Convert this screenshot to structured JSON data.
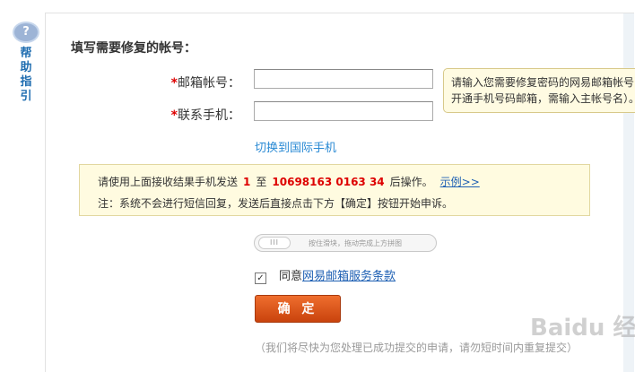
{
  "help": {
    "icon_text": "?",
    "label": "帮助指引"
  },
  "form": {
    "title": "填写需要修复的帐号：",
    "email_label": "邮箱帐号：",
    "email_value": "",
    "phone_label": "联系手机：",
    "phone_value": "",
    "required_mark": "*",
    "tooltip": "请输入您需要修复密码的网易邮箱帐号（如开通手机号码邮箱，需输入主帐号名）。",
    "switch_link": "切换到国际手机"
  },
  "notice": {
    "line1_prefix": "请使用上面接收结果手机发送",
    "code": "1",
    "to_text": "至",
    "number": "10698163 0163 34",
    "line1_suffix": "后操作。",
    "example_link": "示例>>",
    "line2": "注：系统不会进行短信回复，发送后直接点击下方【确定】按钮开始申诉。"
  },
  "slider": {
    "knob_text": "III",
    "hint": "按住滑块，拖动完成上方拼图"
  },
  "agreement": {
    "check_mark": "✓",
    "text": "同意",
    "link": "网易邮箱服务条款"
  },
  "confirm_button": "确 定",
  "footer_note": "（我们将尽快为您处理已成功提交的申请，请勿短时间内重复提交）",
  "watermark": "Baidu 经验"
}
